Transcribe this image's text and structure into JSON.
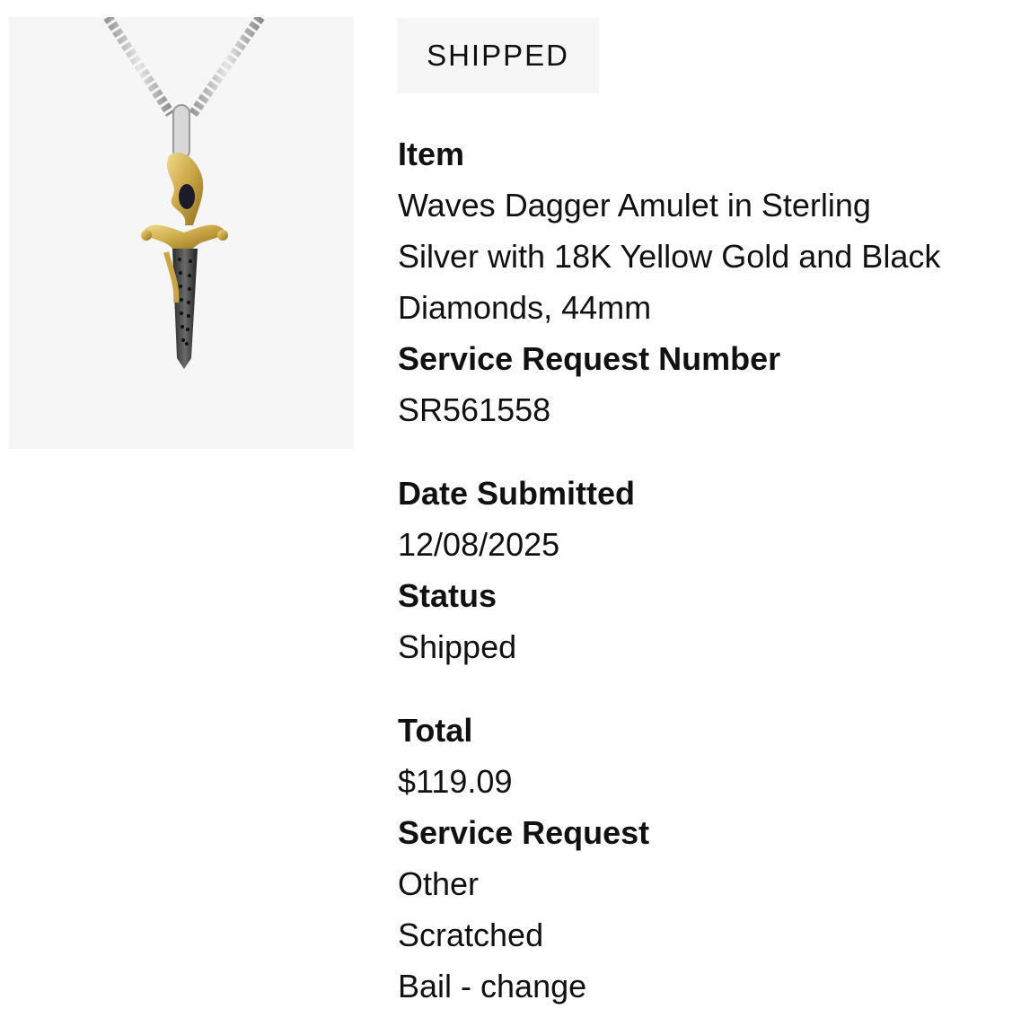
{
  "badge": {
    "status": "SHIPPED"
  },
  "item": {
    "label": "Item",
    "name_lines": [
      "Waves Dagger Amulet in Sterling",
      "Silver with 18K Yellow Gold and Black",
      "Diamonds, 44mm"
    ]
  },
  "service_request_number": {
    "label": "Service Request Number",
    "value": "SR561558"
  },
  "date_submitted": {
    "label": "Date Submitted",
    "value": "12/08/2025"
  },
  "status": {
    "label": "Status",
    "value": "Shipped"
  },
  "total": {
    "label": "Total",
    "value": "$119.09"
  },
  "service_request": {
    "label": "Service Request",
    "values": [
      "Other",
      "Scratched",
      "Bail - change"
    ]
  },
  "colors": {
    "panel_bg": "#f6f6f6",
    "text": "#111111",
    "gold": "#c9a544",
    "silver": "#c9c9c9",
    "blade": "#3a3a3a"
  }
}
